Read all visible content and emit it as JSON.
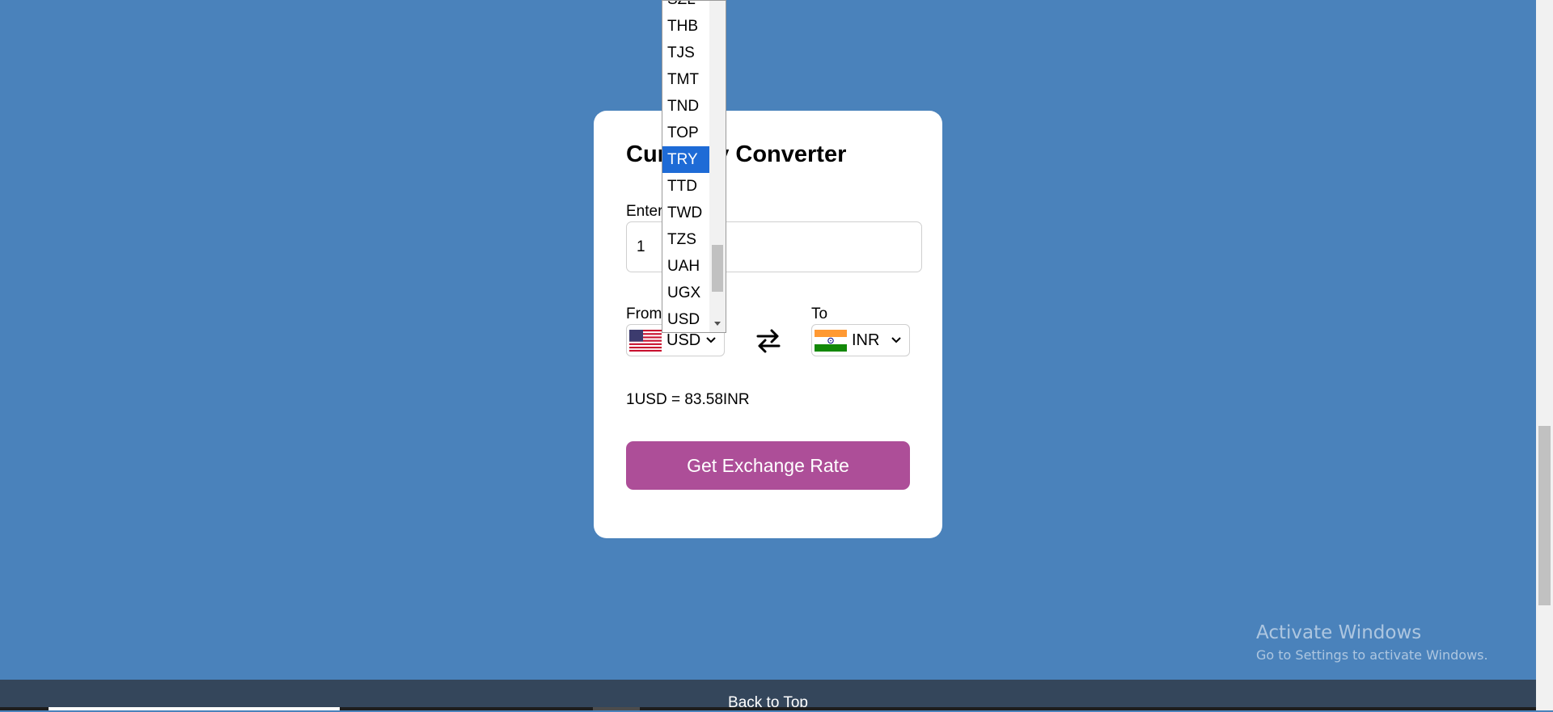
{
  "app": {
    "title": "Currency Converter",
    "amount_label": "Enter Amount",
    "amount_value": "1",
    "from_label": "From",
    "to_label": "To",
    "from_currency": "USD",
    "to_currency": "INR",
    "from_flag": "united-states-flag",
    "to_flag": "india-flag",
    "swap_icon": "swap-arrows-icon",
    "rate_text": "1USD = 83.58INR",
    "get_rate_label": "Get Exchange Rate"
  },
  "dropdown": {
    "options": [
      "SZL",
      "THB",
      "TJS",
      "TMT",
      "TND",
      "TOP",
      "TRY",
      "TTD",
      "TWD",
      "TZS",
      "UAH",
      "UGX",
      "USD"
    ],
    "highlighted": "TRY"
  },
  "footer": {
    "back_to_top": "Back to Top"
  },
  "watermark": {
    "line1": "Activate Windows",
    "line2": "Go to Settings to activate Windows."
  },
  "colors": {
    "page_background": "#4a82bb",
    "button": "#ad4e98",
    "highlight": "#1e6bd6",
    "footer": "#34465b"
  }
}
